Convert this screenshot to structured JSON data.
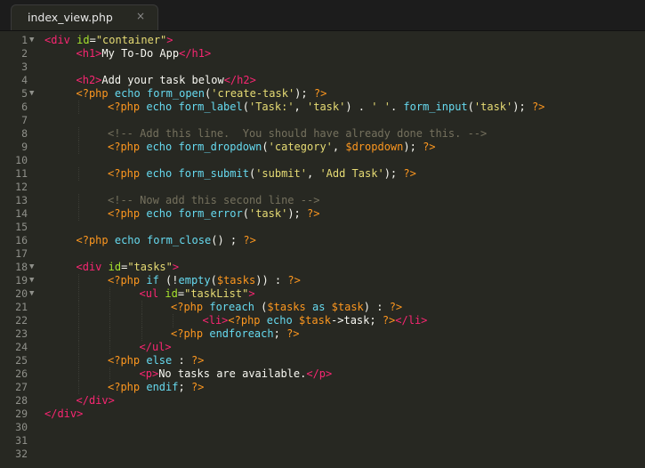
{
  "tab": {
    "filename": "index_view.php",
    "close_glyph": "×"
  },
  "theme": {
    "background": "#272822",
    "tag": "#f92672",
    "attribute": "#a6e22e",
    "string": "#e6db74",
    "php_delimiter": "#fd971f",
    "function": "#66d9ef",
    "comment": "#75715e"
  },
  "lines": [
    {
      "n": "1",
      "fold": true,
      "indent": 0,
      "tokens": [
        [
          "tag",
          "<div "
        ],
        [
          "attr",
          "id"
        ],
        [
          "op",
          "="
        ],
        [
          "str",
          "\"container\""
        ],
        [
          "tag",
          ">"
        ]
      ]
    },
    {
      "n": "2",
      "fold": false,
      "indent": 1,
      "tokens": [
        [
          "tag",
          "<h1>"
        ],
        [
          "txt",
          "My To-Do App"
        ],
        [
          "tag",
          "</h1>"
        ]
      ]
    },
    {
      "n": "3",
      "fold": false,
      "indent": 0,
      "tokens": []
    },
    {
      "n": "4",
      "fold": false,
      "indent": 1,
      "tokens": [
        [
          "tag",
          "<h2>"
        ],
        [
          "txt",
          "Add your task below"
        ],
        [
          "tag",
          "</h2>"
        ]
      ]
    },
    {
      "n": "5",
      "fold": true,
      "indent": 1,
      "tokens": [
        [
          "php",
          "<?php "
        ],
        [
          "fn",
          "echo form_open"
        ],
        [
          "op",
          "("
        ],
        [
          "str",
          "'create-task'"
        ],
        [
          "op",
          "); "
        ],
        [
          "php",
          "?>"
        ]
      ]
    },
    {
      "n": "6",
      "fold": false,
      "indent": 2,
      "tokens": [
        [
          "php",
          "<?php "
        ],
        [
          "fn",
          "echo form_label"
        ],
        [
          "op",
          "("
        ],
        [
          "str",
          "'Task:'"
        ],
        [
          "op",
          ", "
        ],
        [
          "str",
          "'task'"
        ],
        [
          "op",
          ") . "
        ],
        [
          "str",
          "' '"
        ],
        [
          "op",
          ". "
        ],
        [
          "fn",
          "form_input"
        ],
        [
          "op",
          "("
        ],
        [
          "str",
          "'task'"
        ],
        [
          "op",
          "); "
        ],
        [
          "php",
          "?>"
        ]
      ]
    },
    {
      "n": "7",
      "fold": false,
      "indent": 0,
      "tokens": []
    },
    {
      "n": "8",
      "fold": false,
      "indent": 2,
      "tokens": [
        [
          "com",
          "<!-- Add this line.  You should have already done this. -->"
        ]
      ]
    },
    {
      "n": "9",
      "fold": false,
      "indent": 2,
      "tokens": [
        [
          "php",
          "<?php "
        ],
        [
          "fn",
          "echo form_dropdown"
        ],
        [
          "op",
          "("
        ],
        [
          "str",
          "'category'"
        ],
        [
          "op",
          ", "
        ],
        [
          "var",
          "$dropdown"
        ],
        [
          "op",
          "); "
        ],
        [
          "php",
          "?>"
        ]
      ]
    },
    {
      "n": "10",
      "fold": false,
      "indent": 0,
      "tokens": []
    },
    {
      "n": "11",
      "fold": false,
      "indent": 2,
      "tokens": [
        [
          "php",
          "<?php "
        ],
        [
          "fn",
          "echo form_submit"
        ],
        [
          "op",
          "("
        ],
        [
          "str",
          "'submit'"
        ],
        [
          "op",
          ", "
        ],
        [
          "str",
          "'Add Task'"
        ],
        [
          "op",
          "); "
        ],
        [
          "php",
          "?>"
        ]
      ]
    },
    {
      "n": "12",
      "fold": false,
      "indent": 0,
      "tokens": []
    },
    {
      "n": "13",
      "fold": false,
      "indent": 2,
      "tokens": [
        [
          "com",
          "<!-- Now add this second line -->"
        ]
      ]
    },
    {
      "n": "14",
      "fold": false,
      "indent": 2,
      "tokens": [
        [
          "php",
          "<?php "
        ],
        [
          "fn",
          "echo form_error"
        ],
        [
          "op",
          "("
        ],
        [
          "str",
          "'task'"
        ],
        [
          "op",
          "); "
        ],
        [
          "php",
          "?>"
        ]
      ]
    },
    {
      "n": "15",
      "fold": false,
      "indent": 0,
      "tokens": []
    },
    {
      "n": "16",
      "fold": false,
      "indent": 1,
      "tokens": [
        [
          "php",
          "<?php "
        ],
        [
          "fn",
          "echo form_close"
        ],
        [
          "op",
          "() ; "
        ],
        [
          "php",
          "?>"
        ]
      ]
    },
    {
      "n": "17",
      "fold": false,
      "indent": 0,
      "tokens": []
    },
    {
      "n": "18",
      "fold": true,
      "indent": 1,
      "tokens": [
        [
          "tag",
          "<div "
        ],
        [
          "attr",
          "id"
        ],
        [
          "op",
          "="
        ],
        [
          "str",
          "\"tasks\""
        ],
        [
          "tag",
          ">"
        ]
      ]
    },
    {
      "n": "19",
      "fold": true,
      "indent": 2,
      "tokens": [
        [
          "php",
          "<?php "
        ],
        [
          "kw",
          "if "
        ],
        [
          "op",
          "(!"
        ],
        [
          "fn",
          "empty"
        ],
        [
          "op",
          "("
        ],
        [
          "var",
          "$tasks"
        ],
        [
          "op",
          ")) : "
        ],
        [
          "php",
          "?>"
        ]
      ]
    },
    {
      "n": "20",
      "fold": true,
      "indent": 3,
      "tokens": [
        [
          "tag",
          "<ul "
        ],
        [
          "attr",
          "id"
        ],
        [
          "op",
          "="
        ],
        [
          "str",
          "\"taskList\""
        ],
        [
          "tag",
          ">"
        ]
      ]
    },
    {
      "n": "21",
      "fold": false,
      "indent": 4,
      "tokens": [
        [
          "php",
          "<?php "
        ],
        [
          "kw",
          "foreach "
        ],
        [
          "op",
          "("
        ],
        [
          "var",
          "$tasks "
        ],
        [
          "kw",
          "as "
        ],
        [
          "var",
          "$task"
        ],
        [
          "op",
          ") : "
        ],
        [
          "php",
          "?>"
        ]
      ]
    },
    {
      "n": "22",
      "fold": false,
      "indent": 5,
      "tokens": [
        [
          "tag",
          "<li>"
        ],
        [
          "php",
          "<?php "
        ],
        [
          "fn",
          "echo "
        ],
        [
          "var",
          "$task"
        ],
        [
          "op",
          "->task; "
        ],
        [
          "php",
          "?>"
        ],
        [
          "tag",
          "</li>"
        ]
      ]
    },
    {
      "n": "23",
      "fold": false,
      "indent": 4,
      "tokens": [
        [
          "php",
          "<?php "
        ],
        [
          "kw",
          "endforeach"
        ],
        [
          "op",
          "; "
        ],
        [
          "php",
          "?>"
        ]
      ]
    },
    {
      "n": "24",
      "fold": false,
      "indent": 3,
      "tokens": [
        [
          "tag",
          "</ul>"
        ]
      ]
    },
    {
      "n": "25",
      "fold": false,
      "indent": 2,
      "tokens": [
        [
          "php",
          "<?php "
        ],
        [
          "kw",
          "else "
        ],
        [
          "op",
          ": "
        ],
        [
          "php",
          "?>"
        ]
      ]
    },
    {
      "n": "26",
      "fold": false,
      "indent": 3,
      "tokens": [
        [
          "tag",
          "<p>"
        ],
        [
          "txt",
          "No tasks are available."
        ],
        [
          "tag",
          "</p>"
        ]
      ]
    },
    {
      "n": "27",
      "fold": false,
      "indent": 2,
      "tokens": [
        [
          "php",
          "<?php "
        ],
        [
          "kw",
          "endif"
        ],
        [
          "op",
          "; "
        ],
        [
          "php",
          "?>"
        ]
      ]
    },
    {
      "n": "28",
      "fold": false,
      "indent": 1,
      "tokens": [
        [
          "tag",
          "</div>"
        ]
      ]
    },
    {
      "n": "29",
      "fold": false,
      "indent": 0,
      "tokens": [
        [
          "tag",
          "</div>"
        ]
      ]
    },
    {
      "n": "30",
      "fold": false,
      "indent": 0,
      "tokens": []
    },
    {
      "n": "31",
      "fold": false,
      "indent": 0,
      "tokens": []
    },
    {
      "n": "32",
      "fold": false,
      "indent": 0,
      "tokens": []
    }
  ]
}
